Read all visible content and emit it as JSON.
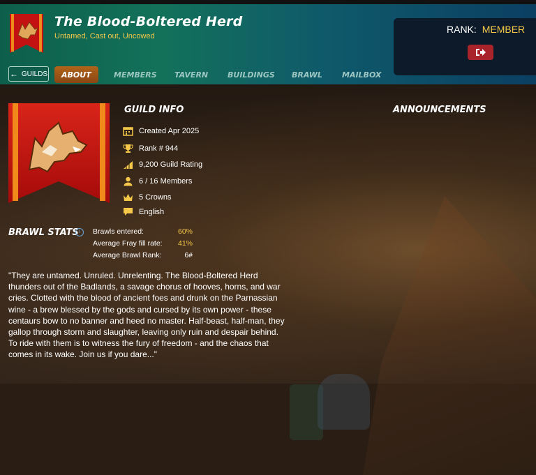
{
  "guild": {
    "name": "The Blood-Boltered Herd",
    "tagline": "Untamed, Cast out, Uncowed"
  },
  "rank_panel": {
    "label": "RANK:",
    "value": "MEMBER",
    "logout_icon": "logout-icon"
  },
  "nav": {
    "guilds_button": "GUILDS",
    "tabs": [
      "ABOUT",
      "MEMBERS",
      "TAVERN",
      "BUILDINGS",
      "BRAWL",
      "MAILBOX"
    ],
    "active_tab": "ABOUT"
  },
  "guild_info": {
    "title": "GUILD INFO",
    "created": "Created Apr 2025",
    "rank": "Rank # 944",
    "rating": "9,200 Guild Rating",
    "members": "6 / 16 Members",
    "crowns": "5 Crowns",
    "language": "English"
  },
  "announcements": {
    "title": "ANNOUNCEMENTS"
  },
  "brawl_stats": {
    "title": "BRAWL STATS",
    "rows": [
      {
        "label": "Brawls entered:",
        "value": "60%"
      },
      {
        "label": "Average Fray fill rate:",
        "value": "41%"
      },
      {
        "label": "Average Brawl Rank:",
        "value": "6#"
      }
    ]
  },
  "description": "\"They are untamed. Unruled. Unrelenting. The Blood-Boltered Herd thunders out of the Badlands, a savage chorus of hooves, horns, and war cries. Clotted with the blood of ancient foes and drunk on the Parnassian wine - a brew blessed by the gods and cursed by its own power - these centaurs bow to no banner and heed no master. Half-beast, half-man, they gallop through storm and slaughter, leaving only ruin and despair behind. To ride with them is to witness the fury of freedom - and the chaos that comes in its wake. Join us if you dare...\"",
  "colors": {
    "accent_gold": "#f5c84a",
    "active_tab": "#a65e18",
    "logout_red": "#a8242a",
    "header_teal": "#13715a"
  }
}
